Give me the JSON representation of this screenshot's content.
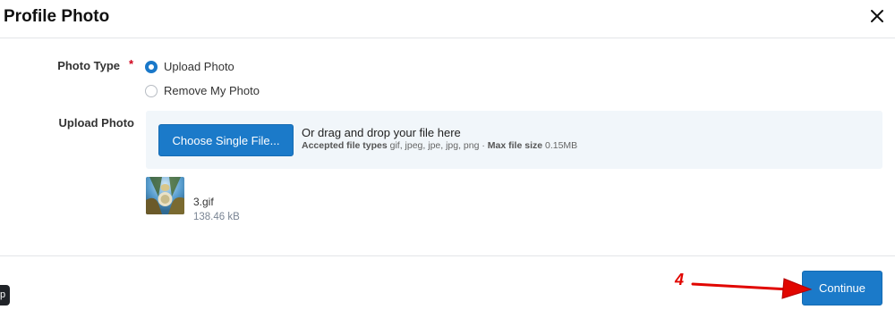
{
  "dialog": {
    "title": "Profile Photo"
  },
  "form": {
    "photo_type": {
      "label": "Photo Type",
      "required_marker": "*",
      "options": [
        {
          "label": "Upload Photo",
          "checked": true
        },
        {
          "label": "Remove My Photo",
          "checked": false
        }
      ]
    },
    "upload": {
      "label": "Upload Photo",
      "button_label": "Choose Single File...",
      "drag_text": "Or drag and drop your file here",
      "accepted_label": "Accepted file types",
      "accepted_types": "gif, jpeg, jpe, jpg, png",
      "separator": "·",
      "max_size_label": "Max file size",
      "max_size": "0.15MB"
    },
    "uploaded_file": {
      "name": "3.gif",
      "size": "138.46 kB"
    }
  },
  "footer": {
    "continue_label": "Continue"
  },
  "annotation": {
    "step": "4",
    "color": "#e10600"
  },
  "tooltip_stub": {
    "text": "p"
  },
  "colors": {
    "primary": "#1b7ac9",
    "dropzone_bg": "#f1f6fa",
    "required": "#d0021b"
  }
}
